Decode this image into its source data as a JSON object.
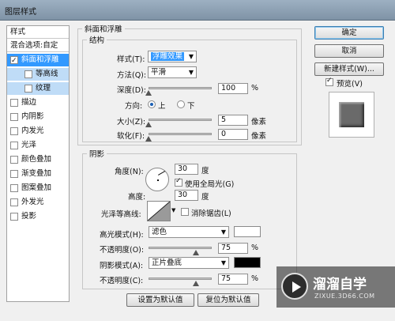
{
  "window": {
    "title": "图层样式"
  },
  "left_panel": {
    "header": "样式",
    "blend_options": "混合选项:自定",
    "items": [
      {
        "label": "斜面和浮雕",
        "checked": true
      },
      {
        "label": "等高线",
        "checked": false
      },
      {
        "label": "纹理",
        "checked": false
      },
      {
        "label": "描边",
        "checked": false
      },
      {
        "label": "内阴影",
        "checked": false
      },
      {
        "label": "内发光",
        "checked": false
      },
      {
        "label": "光泽",
        "checked": false
      },
      {
        "label": "颜色叠加",
        "checked": false
      },
      {
        "label": "渐变叠加",
        "checked": false
      },
      {
        "label": "图案叠加",
        "checked": false
      },
      {
        "label": "外发光",
        "checked": false
      },
      {
        "label": "投影",
        "checked": false
      }
    ]
  },
  "bevel": {
    "section_title": "斜面和浮雕",
    "structure_title": "结构",
    "style_label": "样式(T):",
    "style_value": "浮雕效果",
    "method_label": "方法(Q):",
    "method_value": "平滑",
    "depth_label": "深度(D):",
    "depth_value": "100",
    "depth_unit": "%",
    "depth_level": 0.0,
    "direction_label": "方向:",
    "direction_up": "上",
    "direction_down": "下",
    "size_label": "大小(Z):",
    "size_value": "5",
    "size_unit": "像素",
    "size_level": 0.0,
    "soften_label": "软化(F):",
    "soften_value": "0",
    "soften_unit": "像素",
    "soften_level": 0.0
  },
  "shading": {
    "title": "阴影",
    "angle_label": "角度(N):",
    "angle_value": "30",
    "angle_unit": "度",
    "global_light_label": "使用全局光(G)",
    "altitude_label": "高度:",
    "altitude_value": "30",
    "altitude_unit": "度",
    "gloss_label": "光泽等高线:",
    "antialias_label": "消除锯齿(L)",
    "highlight_mode_label": "高光模式(H):",
    "highlight_mode_value": "滤色",
    "highlight_color": "#ffffff",
    "highlight_opacity_label": "不透明度(O):",
    "highlight_opacity_value": "75",
    "highlight_opacity_unit": "%",
    "highlight_opacity_level": 0.75,
    "shadow_mode_label": "阴影模式(A):",
    "shadow_mode_value": "正片叠底",
    "shadow_color": "#000000",
    "shadow_opacity_label": "不透明度(C):",
    "shadow_opacity_value": "75",
    "shadow_opacity_unit": "%",
    "shadow_opacity_level": 0.75
  },
  "bottom_buttons": {
    "make_default": "设置为默认值",
    "reset_default": "复位为默认值"
  },
  "right_buttons": {
    "ok": "确定",
    "cancel": "取消",
    "new_style": "新建样式(W)...",
    "preview_label": "预览(V)"
  },
  "watermark": {
    "brand": "溜溜自学",
    "url": "ZIXUE.3D66.COM"
  }
}
